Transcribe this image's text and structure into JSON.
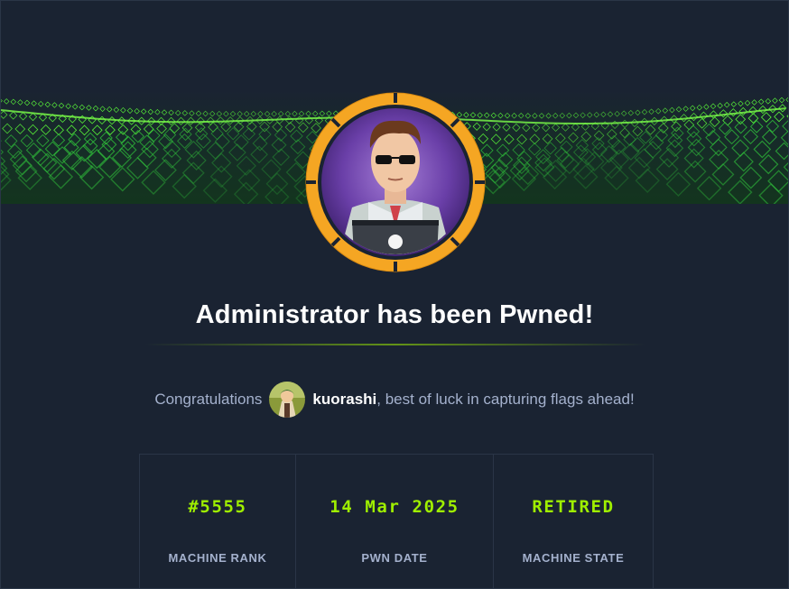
{
  "machine": {
    "title": "Administrator has been Pwned!"
  },
  "congrats": {
    "prefix": "Congratulations",
    "username": "kuorashi",
    "suffix": ", best of luck in capturing flags ahead!"
  },
  "stats": [
    {
      "value": "#5555",
      "label": "MACHINE RANK"
    },
    {
      "value": "14 Mar 2025",
      "label": "PWN DATE"
    },
    {
      "value": "RETIRED",
      "label": "MACHINE STATE"
    }
  ],
  "colors": {
    "background": "#1a2332",
    "accent_green": "#9fef00",
    "ring_orange": "#f5a623",
    "muted_text": "#a4b1cd",
    "banner_green": "#3ad63a"
  },
  "icons": {
    "machine_avatar": "hacker-avatar-icon",
    "user_avatar": "user-avatar-icon"
  }
}
